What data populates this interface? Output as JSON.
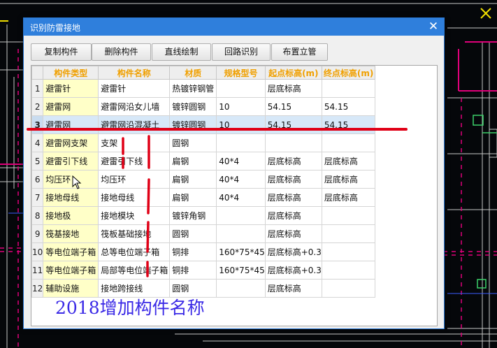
{
  "dialog": {
    "title": "识别防雷接地",
    "close_glyph": "✕"
  },
  "toolbar": [
    {
      "label": "复制构件"
    },
    {
      "label": "删除构件"
    },
    {
      "label": "直线绘制"
    },
    {
      "label": "回路识别"
    },
    {
      "label": "布置立管"
    }
  ],
  "table": {
    "headers": [
      "",
      "构件类型",
      "构件名称",
      "材质",
      "规格型号",
      "起点标高(m)",
      "终点标高(m)"
    ],
    "selected_row": 3,
    "rows": [
      [
        "1",
        "避雷针",
        "避雷针",
        "热镀锌钢管",
        "",
        "层底标高",
        ""
      ],
      [
        "2",
        "避雷网",
        "避雷网沿女儿墙",
        "镀锌圆钢",
        "10",
        "54.15",
        "54.15"
      ],
      [
        "3",
        "避雷网",
        "避雷网沿混凝土",
        "镀锌圆钢",
        "10",
        "54.15",
        "54.15"
      ],
      [
        "4",
        "避雷网支架",
        "支架",
        "圆钢",
        "",
        "",
        ""
      ],
      [
        "5",
        "避雷引下线",
        "避雷引下线",
        "扁钢",
        "40*4",
        "层底标高",
        "层底标高"
      ],
      [
        "6",
        "均压环",
        "均压环",
        "扁钢",
        "40*4",
        "层底标高",
        "层底标高"
      ],
      [
        "7",
        "接地母线",
        "接地母线",
        "扁钢",
        "40*4",
        "层底标高",
        "层底标高"
      ],
      [
        "8",
        "接地极",
        "接地模块",
        "镀锌角钢",
        "",
        "层底标高",
        ""
      ],
      [
        "9",
        "筏基接地",
        "筏板基础接地",
        "圆钢",
        "",
        "层底标高",
        ""
      ],
      [
        "10",
        "等电位端子箱",
        "总等电位端子箱",
        "铜排",
        "160*75*45",
        "层底标高+0.3",
        ""
      ],
      [
        "11",
        "等电位端子箱",
        "局部等电位端子箱",
        "铜排",
        "160*75*45",
        "层底标高+0.3",
        ""
      ],
      [
        "12",
        "辅助设施",
        "接地跨接线",
        "圆钢",
        "",
        "层底标高",
        ""
      ]
    ]
  },
  "annotation": {
    "text": "2018增加构件名称"
  },
  "colors": {
    "titlebar": "#2f7fdc",
    "header_text": "#f0a000",
    "type_cell": "#ffffc8",
    "annotation_red": "#e00016",
    "annotation_blue": "#3a29e6"
  }
}
